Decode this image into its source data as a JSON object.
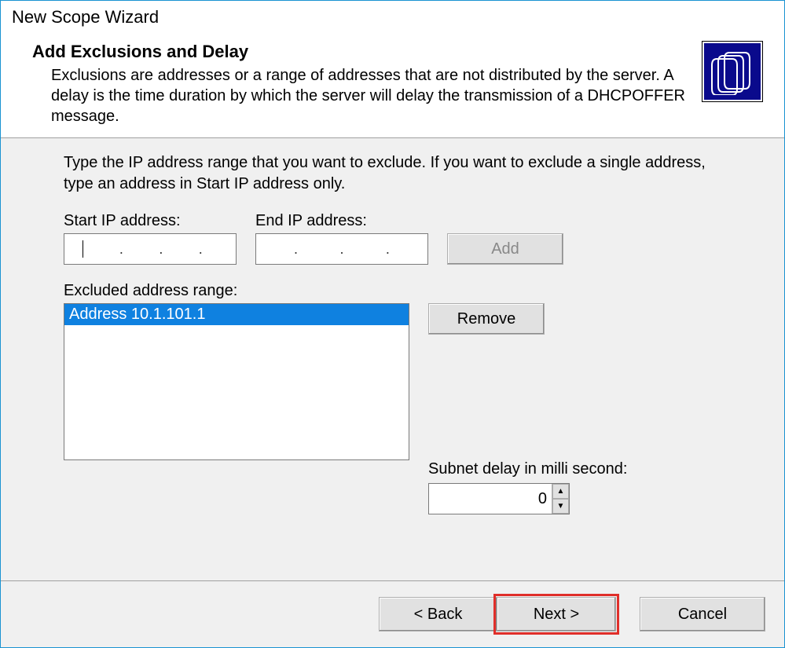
{
  "window_title": "New Scope Wizard",
  "header": {
    "title": "Add Exclusions and Delay",
    "description": "Exclusions are addresses or a range of addresses that are not distributed by the server. A delay is the time duration by which the server will delay the transmission of a DHCPOFFER message."
  },
  "content": {
    "instruction": "Type the IP address range that you want to exclude. If you want to exclude a single address, type an address in Start IP address only.",
    "start_ip_label": "Start IP address:",
    "end_ip_label": "End IP address:",
    "add_button": "Add",
    "excluded_label": "Excluded address range:",
    "excluded_items": [
      "Address 10.1.101.1"
    ],
    "remove_button": "Remove",
    "subnet_delay_label": "Subnet delay in milli second:",
    "subnet_delay_value": "0"
  },
  "footer": {
    "back": "< Back",
    "next": "Next >",
    "cancel": "Cancel"
  }
}
